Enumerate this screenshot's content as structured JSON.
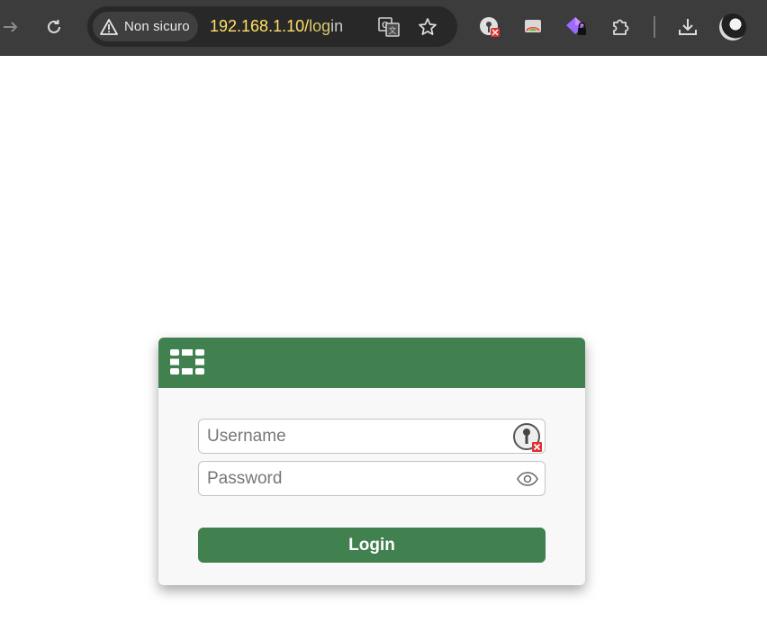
{
  "browser": {
    "security_chip": {
      "label": "Non sicuro",
      "icon": "warning-triangle-icon"
    },
    "url": {
      "host_highlight": "192.168.1.10/",
      "path_highlight": "log",
      "path_rest": "in"
    },
    "icons": [
      "forward-arrow-icon",
      "reload-icon",
      "translate-icon",
      "bookmark-star-icon",
      "password-manager-extension-icon",
      "cast-extension-icon",
      "privacy-extension-icon",
      "extensions-puzzle-icon",
      "download-icon",
      "profile-avatar"
    ]
  },
  "login": {
    "header_color": "#41804f",
    "logo": "fortinet-logo",
    "username_placeholder": "Username",
    "password_placeholder": "Password",
    "username_value": "",
    "password_value": "",
    "login_label": "Login"
  }
}
